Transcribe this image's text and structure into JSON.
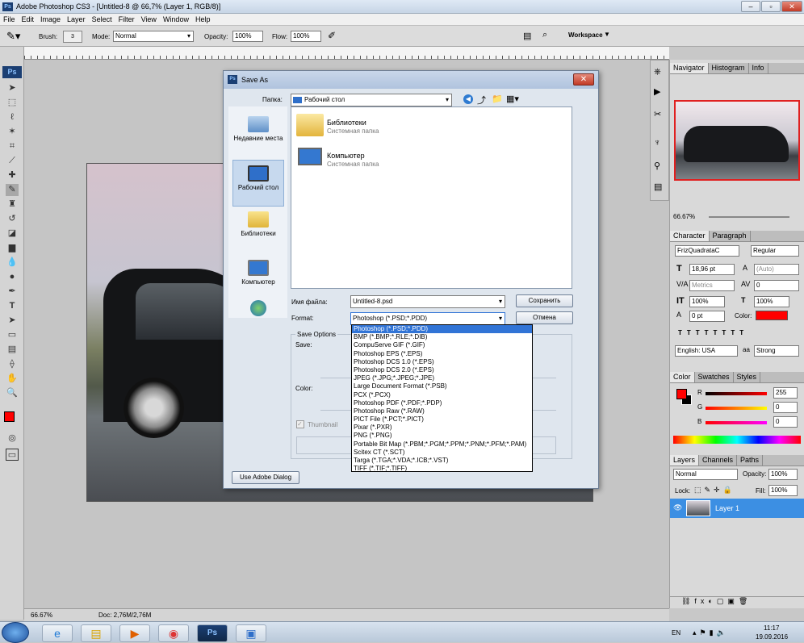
{
  "window": {
    "title": "Adobe Photoshop CS3 - [Untitled-8 @ 66,7% (Layer 1, RGB/8)]"
  },
  "menu": [
    "File",
    "Edit",
    "Image",
    "Layer",
    "Select",
    "Filter",
    "View",
    "Window",
    "Help"
  ],
  "options": {
    "brush_label": "Brush:",
    "brush_size": "3",
    "mode_label": "Mode:",
    "mode_value": "Normal",
    "opacity_label": "Opacity:",
    "opacity_value": "100%",
    "flow_label": "Flow:",
    "flow_value": "100%",
    "workspace": "Workspace"
  },
  "dialog": {
    "title": "Save As",
    "folder_label": "Папка:",
    "folder_value": "Рабочий стол",
    "places": [
      "Недавние места",
      "Рабочий стол",
      "Библиотеки",
      "Компьютер"
    ],
    "files": [
      {
        "name": "Библиотеки",
        "type": "Системная папка"
      },
      {
        "name": "Компьютер",
        "type": "Системная папка"
      }
    ],
    "filename_label": "Имя файла:",
    "filename_value": "Untitled-8.psd",
    "format_label": "Format:",
    "format_value": "Photoshop (*.PSD;*.PDD)",
    "save_button": "Сохранить",
    "cancel_button": "Отмена",
    "save_options": "Save Options",
    "save_label": "Save:",
    "color_label": "Color:",
    "thumbnail_label": "Thumbnail",
    "adobe_dialog_button": "Use Adobe Dialog",
    "formats": [
      "Photoshop (*.PSD;*.PDD)",
      "BMP (*.BMP;*.RLE;*.DIB)",
      "CompuServe GIF (*.GIF)",
      "Photoshop EPS (*.EPS)",
      "Photoshop DCS 1.0 (*.EPS)",
      "Photoshop DCS 2.0 (*.EPS)",
      "JPEG (*.JPG;*.JPEG;*.JPE)",
      "Large Document Format (*.PSB)",
      "PCX (*.PCX)",
      "Photoshop PDF (*.PDF;*.PDP)",
      "Photoshop Raw (*.RAW)",
      "PICT File (*.PCT;*.PICT)",
      "Pixar (*.PXR)",
      "PNG (*.PNG)",
      "Portable Bit Map (*.PBM;*.PGM;*.PPM;*.PNM;*.PFM;*.PAM)",
      "Scitex CT (*.SCT)",
      "Targa (*.TGA;*.VDA;*.ICB;*.VST)",
      "TIFF (*.TIF;*.TIFF)"
    ]
  },
  "panels": {
    "navigator_tabs": [
      "Navigator",
      "Histogram",
      "Info"
    ],
    "nav_zoom": "66.67%",
    "character_tabs": [
      "Character",
      "Paragraph"
    ],
    "font_family": "FrizQuadrataC",
    "font_style": "Regular",
    "font_size": "18,96 pt",
    "leading": "(Auto)",
    "kerning": "Metrics",
    "tracking": "0",
    "vscale": "100%",
    "hscale": "100%",
    "baseline": "0 pt",
    "color_label": "Color:",
    "language": "English: USA",
    "antialias_label": "aa",
    "antialias": "Strong",
    "color_tabs": [
      "Color",
      "Swatches",
      "Styles"
    ],
    "rgb": [
      {
        "ch": "R",
        "val": "255"
      },
      {
        "ch": "G",
        "val": "0"
      },
      {
        "ch": "B",
        "val": "0"
      }
    ],
    "layers_tabs": [
      "Layers",
      "Channels",
      "Paths"
    ],
    "blend": "Normal",
    "opacity_label": "Opacity:",
    "opacity": "100%",
    "lock_label": "Lock:",
    "fill_label": "Fill:",
    "fill": "100%",
    "layer_name": "Layer 1",
    "fg_color": "#ff0000",
    "accent": "#3174d6"
  },
  "status": {
    "zoom": "66.67%",
    "doc": "Doc: 2,76M/2,76M"
  },
  "taskbar": {
    "lang": "EN",
    "time": "11:17",
    "date": "19.09.2016"
  }
}
